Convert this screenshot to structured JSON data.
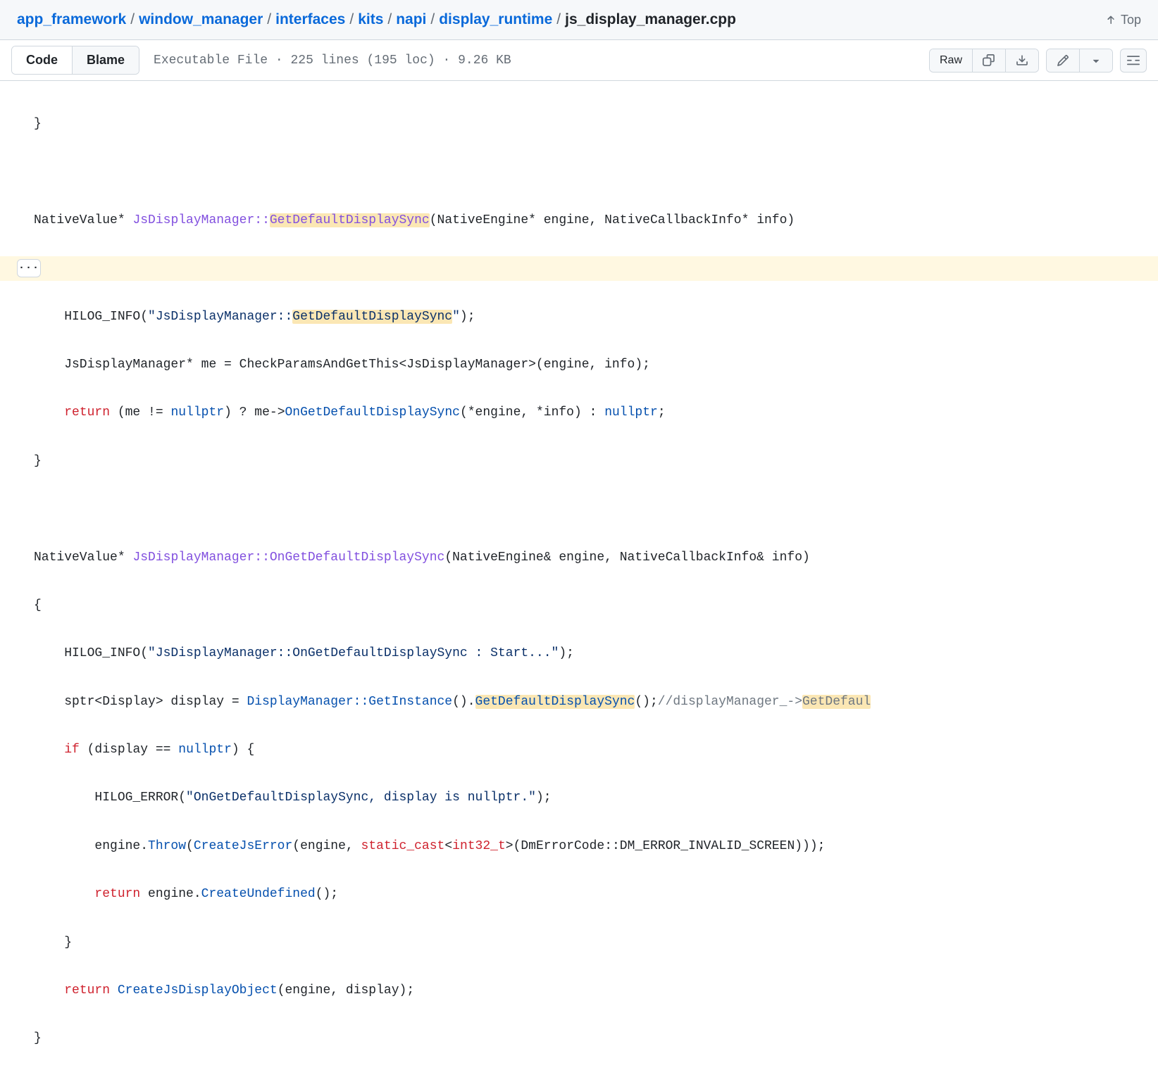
{
  "breadcrumb": {
    "parts": [
      "app_framework",
      "window_manager",
      "interfaces",
      "kits",
      "napi",
      "display_runtime"
    ],
    "current": "js_display_manager.cpp",
    "sep": "/"
  },
  "top_link": {
    "label": "Top"
  },
  "toolbar": {
    "code_tab": "Code",
    "blame_tab": "Blame",
    "file_info": "Executable File · 225 lines (195 loc) · 9.26 KB",
    "raw_label": "Raw"
  },
  "code": {
    "hl_term": "GetDefaultDisplaySync",
    "ellipsis": "···",
    "line01_pre": "}",
    "line03_a": "NativeValue* ",
    "line03_b": "JsDisplayManager::",
    "line03_c": "GetDefaultDisplaySync",
    "line03_d": "(NativeEngine* engine, NativeCallbackInfo* info)",
    "line04_brace": "{",
    "line05_a": "    HILOG_INFO(",
    "line05_b": "\"JsDisplayManager::",
    "line05_c": "GetDefaultDisplaySync",
    "line05_d": "\"",
    "line05_e": ");",
    "line06": "    JsDisplayManager* me = CheckParamsAndGetThis<JsDisplayManager>(engine, info);",
    "line07_a": "    ",
    "line07_b": "return",
    "line07_c": " (me != ",
    "line07_d": "nullptr",
    "line07_e": ") ? me->",
    "line07_f": "OnGetDefaultDisplaySync",
    "line07_g": "(*engine, *info) : ",
    "line07_h": "nullptr",
    "line07_i": ";",
    "line08": "}",
    "line10_a": "NativeValue* ",
    "line10_b": "JsDisplayManager::OnGetDefaultDisplaySync",
    "line10_c": "(NativeEngine& engine, NativeCallbackInfo& info)",
    "line11": "{",
    "line12_a": "    HILOG_INFO(",
    "line12_b": "\"JsDisplayManager::OnGetDefaultDisplaySync : Start...\"",
    "line12_c": ");",
    "line13_a": "    sptr<Display> display = ",
    "line13_b": "DisplayManager::GetInstance",
    "line13_c": "().",
    "line13_d": "GetDefaultDisplaySync",
    "line13_e": "();",
    "line13_f": "//displayManager_->",
    "line13_g": "GetDefaul",
    "line14_a": "    ",
    "line14_b": "if",
    "line14_c": " (display == ",
    "line14_d": "nullptr",
    "line14_e": ") {",
    "line15_a": "        HILOG_ERROR(",
    "line15_b": "\"OnGetDefaultDisplaySync, display is nullptr.\"",
    "line15_c": ");",
    "line16_a": "        engine.",
    "line16_b": "Throw",
    "line16_c": "(",
    "line16_d": "CreateJsError",
    "line16_e": "(engine, ",
    "line16_f": "static_cast",
    "line16_g": "<",
    "line16_h": "int32_t",
    "line16_i": ">(DmErrorCode::DM_ERROR_INVALID_SCREEN)));",
    "line17_a": "        ",
    "line17_b": "return",
    "line17_c": " engine.",
    "line17_d": "CreateUndefined",
    "line17_e": "();",
    "line18": "    }",
    "line19_a": "    ",
    "line19_b": "return",
    "line19_c": " ",
    "line19_d": "CreateJsDisplayObject",
    "line19_e": "(engine, display);",
    "line20": "}"
  }
}
